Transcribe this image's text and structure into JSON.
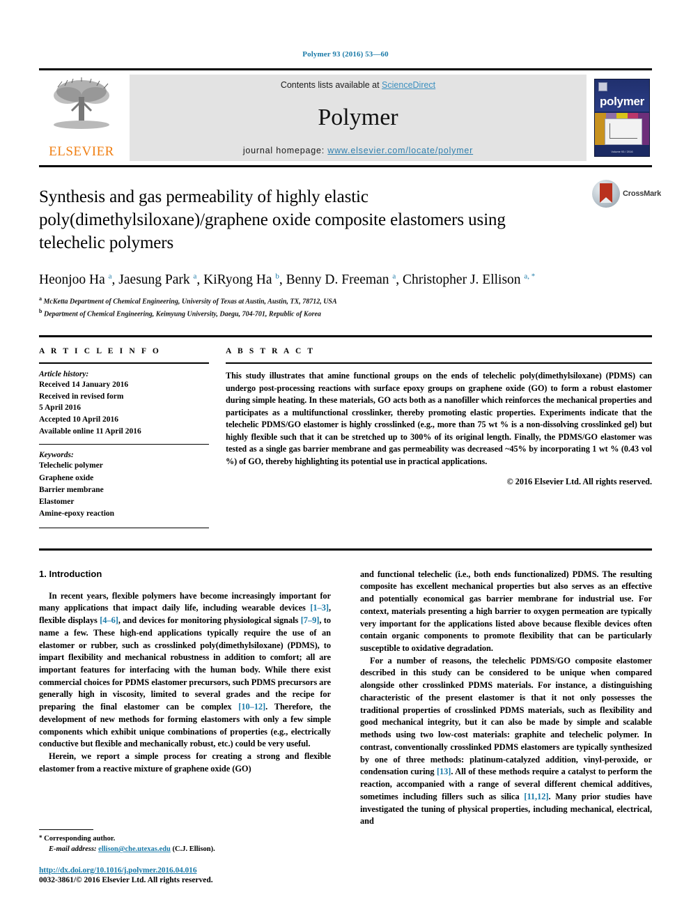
{
  "running_head": "Polymer 93 (2016) 53—60",
  "header": {
    "contents_prefix": "Contents lists available at ",
    "sciencedirect": "ScienceDirect",
    "journal_title": "Polymer",
    "homepage_prefix": "journal homepage: ",
    "homepage_url": "www.elsevier.com/locate/polymer",
    "elsevier_wordmark": "ELSEVIER",
    "cover_title": "polymer",
    "cover_footer": "Volume 93 / 2016",
    "accent_link_color": "#1a7aa8",
    "band_color": "#e3e3e3",
    "cover_bg_color": "#1b2a63",
    "elsevier_orange": "#f07f13"
  },
  "title_block": {
    "title": "Synthesis and gas permeability of highly elastic poly(dimethylsiloxane)/graphene oxide composite elastomers using telechelic polymers",
    "crossmark_label": "CrossMark",
    "authors": [
      {
        "name": "Heonjoo Ha",
        "sup": "a",
        "sep": ", "
      },
      {
        "name": "Jaesung Park",
        "sup": "a",
        "sep": ", "
      },
      {
        "name": "KiRyong Ha",
        "sup": "b",
        "sep": ", "
      },
      {
        "name": "Benny D. Freeman",
        "sup": "a",
        "sep": ", "
      },
      {
        "name": "Christopher J. Ellison",
        "sup": "a, *",
        "sep": ""
      }
    ],
    "affiliations": [
      {
        "marker": "a",
        "text": "McKetta Department of Chemical Engineering, University of Texas at Austin, Austin, TX, 78712, USA"
      },
      {
        "marker": "b",
        "text": "Department of Chemical Engineering, Keimyung University, Daegu, 704-701, Republic of Korea"
      }
    ]
  },
  "article_info": {
    "kicker": "A R T I C L E  I N F O",
    "history_head": "Article history:",
    "history": [
      "Received 14 January 2016",
      "Received in revised form",
      "5 April 2016",
      "Accepted 10 April 2016",
      "Available online 11 April 2016"
    ],
    "keywords_head": "Keywords:",
    "keywords": [
      "Telechelic polymer",
      "Graphene oxide",
      "Barrier membrane",
      "Elastomer",
      "Amine-epoxy reaction"
    ]
  },
  "abstract": {
    "kicker": "A B S T R A C T",
    "text": "This study illustrates that amine functional groups on the ends of telechelic poly(dimethylsiloxane) (PDMS) can undergo post-processing reactions with surface epoxy groups on graphene oxide (GO) to form a robust elastomer during simple heating. In these materials, GO acts both as a nanofiller which reinforces the mechanical properties and participates as a multifunctional crosslinker, thereby promoting elastic properties. Experiments indicate that the telechelic PDMS/GO elastomer is highly crosslinked (e.g., more than 75 wt % is a non-dissolving crosslinked gel) but highly flexible such that it can be stretched up to 300% of its original length. Finally, the PDMS/GO elastomer was tested as a single gas barrier membrane and gas permeability was decreased ~45% by incorporating 1 wt % (0.43 vol %) of GO, thereby highlighting its potential use in practical applications.",
    "copyright": "© 2016 Elsevier Ltd. All rights reserved."
  },
  "body": {
    "section_title": "1. Introduction",
    "left_paragraphs": [
      {
        "segments": [
          {
            "t": "In recent years, flexible polymers have become increasingly important for many applications that impact daily life, including wearable devices "
          },
          {
            "t": "[1–3]",
            "cite": true
          },
          {
            "t": ", flexible displays "
          },
          {
            "t": "[4–6]",
            "cite": true
          },
          {
            "t": ", and devices for monitoring physiological signals "
          },
          {
            "t": "[7–9]",
            "cite": true
          },
          {
            "t": ", to name a few. These high-end applications typically require the use of an elastomer or rubber, such as crosslinked poly(dimethylsiloxane) (PDMS), to impart flexibility and mechanical robustness in addition to comfort; all are important features for interfacing with the human body. While there exist commercial choices for PDMS elastomer precursors, such PDMS precursors are generally high in viscosity, limited to several grades and the recipe for preparing the final elastomer can be complex "
          },
          {
            "t": "[10–12]",
            "cite": true
          },
          {
            "t": ". Therefore, the development of new methods for forming elastomers with only a few simple components which exhibit unique combinations of properties (e.g., electrically conductive but flexible and mechanically robust, etc.) could be very useful."
          }
        ]
      },
      {
        "segments": [
          {
            "t": "Herein, we report a simple process for creating a strong and flexible elastomer from a reactive mixture of graphene oxide (GO)"
          }
        ]
      }
    ],
    "right_paragraphs": [
      {
        "segments": [
          {
            "t": "and functional telechelic (i.e., both ends functionalized) PDMS. The resulting composite has excellent mechanical properties but also serves as an effective and potentially economical gas barrier membrane for industrial use. For context, materials presenting a high barrier to oxygen permeation are typically very important for the applications listed above because flexible devices often contain organic components to promote flexibility that can be particularly susceptible to oxidative degradation."
          }
        ]
      },
      {
        "segments": [
          {
            "t": "For a number of reasons, the telechelic PDMS/GO composite elastomer described in this study can be considered to be unique when compared alongside other crosslinked PDMS materials. For instance, a distinguishing characteristic of the present elastomer is that it not only possesses the traditional properties of crosslinked PDMS materials, such as flexibility and good mechanical integrity, but it can also be made by simple and scalable methods using two low-cost materials: graphite and telechelic polymer. In contrast, conventionally crosslinked PDMS elastomers are typically synthesized by one of three methods: platinum-catalyzed addition, vinyl-peroxide, or condensation curing "
          },
          {
            "t": "[13]",
            "cite": true
          },
          {
            "t": ". All of these methods require a catalyst to perform the reaction, accompanied with a range of several different chemical additives, sometimes including fillers such as silica "
          },
          {
            "t": "[11,12]",
            "cite": true
          },
          {
            "t": ". Many prior studies have investigated the tuning of physical properties, including mechanical, electrical, and"
          }
        ]
      }
    ]
  },
  "footer": {
    "corresponding_marker": "*",
    "corresponding_label": "Corresponding author.",
    "email_label": "E-mail address:",
    "email": "ellison@che.utexas.edu",
    "email_suffix": "(C.J. Ellison).",
    "doi": "http://dx.doi.org/10.1016/j.polymer.2016.04.016",
    "issn": "0032-3861/© 2016 Elsevier Ltd. All rights reserved."
  }
}
